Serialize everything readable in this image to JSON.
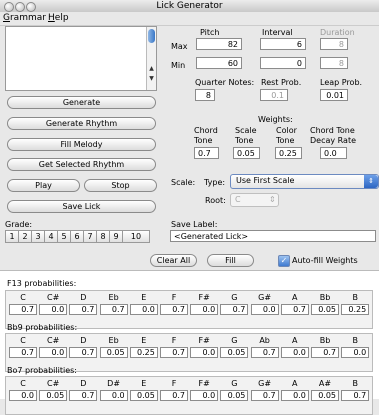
{
  "window": {
    "title": "Lick Generator"
  },
  "menu": [
    "Grammar",
    "Help"
  ],
  "buttons": {
    "generate": "Generate",
    "generate_rhythm": "Generate Rhythm",
    "fill_melody": "Fill Melody",
    "get_selected_rhythm": "Get Selected Rhythm",
    "play": "Play",
    "stop": "Stop",
    "save_lick": "Save Lick",
    "clear_all": "Clear All",
    "fill": "Fill"
  },
  "params": {
    "pitch_label": "Pitch",
    "interval_label": "Interval",
    "duration_label": "Duration",
    "max_label": "Max",
    "min_label": "Min",
    "pitch_max": "82",
    "pitch_min": "60",
    "interval_max": "6",
    "interval_min": "0",
    "duration_max": "8",
    "duration_min": "8",
    "quarter_notes_label": "Quarter Notes:",
    "quarter_notes": "8",
    "rest_prob_label": "Rest Prob.",
    "rest_prob": "0.1",
    "leap_prob_label": "Leap Prob.",
    "leap_prob": "0.01"
  },
  "weights": {
    "title": "Weights:",
    "chord_tone_label": [
      "Chord",
      "Tone"
    ],
    "scale_tone_label": [
      "Scale",
      "Tone"
    ],
    "color_tone_label": [
      "Color",
      "Tone"
    ],
    "decay_label": [
      "Chord Tone",
      "Decay Rate"
    ],
    "chord_tone": "0.7",
    "scale_tone": "0.05",
    "color_tone": "0.25",
    "decay_rate": "0.0"
  },
  "scale": {
    "scale_label": "Scale:",
    "type_label": "Type:",
    "type_value": "Use First Scale",
    "root_label": "Root:",
    "root_value": "C"
  },
  "grade": {
    "label": "Grade:",
    "values": [
      "1",
      "2",
      "3",
      "4",
      "5",
      "6",
      "7",
      "8",
      "9",
      "10"
    ]
  },
  "save_label": {
    "label": "Save Label:",
    "value": "<Generated Lick>"
  },
  "autofill": {
    "label": "Auto-fill Weights",
    "checked": true
  },
  "probabilities": [
    {
      "title": "F13 probabilities:",
      "notes": [
        "C",
        "C#",
        "D",
        "Eb",
        "E",
        "F",
        "F#",
        "G",
        "G#",
        "A",
        "Bb",
        "B"
      ],
      "values": [
        "0.7",
        "0.0",
        "0.7",
        "0.7",
        "0.0",
        "0.7",
        "0.0",
        "0.7",
        "0.0",
        "0.7",
        "0.05",
        "0.25"
      ]
    },
    {
      "title": "Bb9 probabilities:",
      "notes": [
        "C",
        "C#",
        "D",
        "Eb",
        "E",
        "F",
        "F#",
        "G",
        "Ab",
        "A",
        "Bb",
        "B"
      ],
      "values": [
        "0.7",
        "0.0",
        "0.7",
        "0.05",
        "0.25",
        "0.7",
        "0.0",
        "0.05",
        "0.7",
        "0.0",
        "0.7",
        "0.0"
      ]
    },
    {
      "title": "Bo7 probabilities:",
      "notes": [
        "C",
        "C#",
        "D",
        "D#",
        "E",
        "F",
        "F#",
        "G",
        "G#",
        "A",
        "A#",
        "B"
      ],
      "values": [
        "0.0",
        "0.05",
        "0.7",
        "0.0",
        "0.05",
        "0.7",
        "0.0",
        "0.05",
        "0.7",
        "0.0",
        "0.05",
        "0.7"
      ]
    }
  ]
}
